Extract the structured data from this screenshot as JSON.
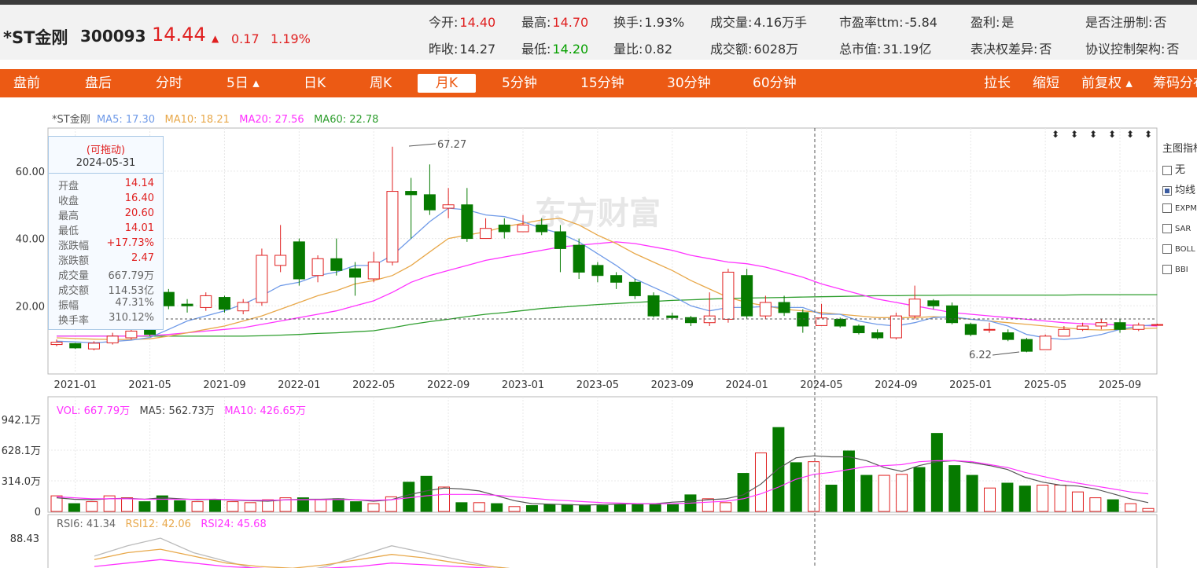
{
  "stock": {
    "name": "*ST金刚",
    "code": "300093",
    "price": "14.44",
    "arrow": "▲",
    "change": "0.17",
    "change_pct": "1.19%"
  },
  "stats_row1": [
    {
      "label": "今开:",
      "value": "14.40",
      "color": "red"
    },
    {
      "label": "最高:",
      "value": "14.70",
      "color": "red"
    },
    {
      "label": "换手:",
      "value": "1.93%",
      "color": "normal"
    },
    {
      "label": "成交量:",
      "value": "4.16万手",
      "color": "normal"
    },
    {
      "label": "市盈率ttm:",
      "value": "-5.84",
      "color": "normal"
    },
    {
      "label": "盈利:",
      "value": "是",
      "color": "normal"
    },
    {
      "label": "是否注册制:",
      "value": "否",
      "color": "normal"
    }
  ],
  "stats_row2": [
    {
      "label": "昨收:",
      "value": "14.27",
      "color": "normal"
    },
    {
      "label": "最低:",
      "value": "14.20",
      "color": "green"
    },
    {
      "label": "量比:",
      "value": "0.82",
      "color": "normal"
    },
    {
      "label": "成交额:",
      "value": "6028万",
      "color": "normal"
    },
    {
      "label": "总市值:",
      "value": "31.19亿",
      "color": "normal"
    },
    {
      "label": "表决权差异:",
      "value": "否",
      "color": "normal"
    },
    {
      "label": "协议控制架构:",
      "value": "否",
      "color": "normal"
    }
  ],
  "tabs": [
    "盘前",
    "盘后",
    "分时",
    "5日 ▴",
    "日K",
    "周K",
    "月K",
    "5分钟",
    "15分钟",
    "30分钟",
    "60分钟"
  ],
  "active_tab": "月K",
  "right_tabs": [
    "拉长",
    "缩短",
    "前复权 ▴",
    "筹码分布"
  ],
  "ma_legend": {
    "name": "*ST金刚",
    "ma5": "MA5: 17.30",
    "ma10": "MA10: 18.21",
    "ma20": "MA20: 27.56",
    "ma60": "MA60: 22.78"
  },
  "tooltip": {
    "draggable": "(可拖动)",
    "date": "2024-05-31",
    "rows": [
      {
        "k": "开盘",
        "v": "14.14"
      },
      {
        "k": "收盘",
        "v": "16.40"
      },
      {
        "k": "最高",
        "v": "20.60"
      },
      {
        "k": "最低",
        "v": "14.01"
      },
      {
        "k": "涨跌幅",
        "v": "+17.73%"
      },
      {
        "k": "涨跌额",
        "v": "2.47"
      },
      {
        "k": "成交量",
        "v": "667.79万"
      },
      {
        "k": "成交额",
        "v": "114.53亿"
      },
      {
        "k": "振幅",
        "v": "47.31%"
      },
      {
        "k": "换手率",
        "v": "310.12%"
      }
    ]
  },
  "watermark": "东方财富",
  "indicator_panel": {
    "title": "主图指标",
    "items": [
      {
        "label": "无",
        "checked": false
      },
      {
        "label": "均线",
        "checked": true
      },
      {
        "label": "EXPMA",
        "checked": false
      },
      {
        "label": "SAR",
        "checked": false
      },
      {
        "label": "BOLL",
        "checked": false
      },
      {
        "label": "BBI",
        "checked": false
      }
    ]
  },
  "price_axis": {
    "labels": [
      "60.00",
      "40.00",
      "20.00"
    ]
  },
  "annotations": {
    "high": "67.27",
    "low": "6.22"
  },
  "time_axis": [
    "2021-01",
    "2021-05",
    "2021-09",
    "2022-01",
    "2022-05",
    "2022-09",
    "2023-01",
    "2023-05",
    "2023-09",
    "2024-01",
    "2024-05",
    "2024-09",
    "2025-01",
    "2025-05",
    "2025-09"
  ],
  "vol_legend": {
    "vol": "VOL: 667.79万",
    "ma5": "MA5: 562.73万",
    "ma10": "MA10: 426.65万"
  },
  "vol_axis": {
    "labels": [
      "942.1万",
      "628.1万",
      "314.0万",
      "0"
    ]
  },
  "rsi_legend": {
    "rsi6": "RSI6: 41.34",
    "rsi12": "RSI12: 42.06",
    "rsi24": "RSI24: 45.68"
  },
  "rsi_axis": {
    "labels": [
      "88.43"
    ]
  },
  "colors": {
    "up": "#e02020",
    "down": "#067a00",
    "ma5": "#6f9ae8",
    "ma10": "#e8a84a",
    "ma20": "#ff33ff",
    "ma60": "#2e9e2e",
    "accent": "#ec5a14"
  },
  "chart_data": {
    "type": "candlestick",
    "title": "",
    "interval": "month",
    "x": [
      "2020-12",
      "2021-01",
      "2021-02",
      "2021-03",
      "2021-04",
      "2021-05",
      "2021-06",
      "2021-07",
      "2021-08",
      "2021-09",
      "2021-10",
      "2021-11",
      "2021-12",
      "2022-01",
      "2022-02",
      "2022-03",
      "2022-04",
      "2022-05",
      "2022-06",
      "2022-07",
      "2022-08",
      "2022-09",
      "2022-10",
      "2022-11",
      "2022-12",
      "2023-01",
      "2023-02",
      "2023-03",
      "2023-04",
      "2023-05",
      "2023-06",
      "2023-07",
      "2023-08",
      "2023-09",
      "2023-10",
      "2023-11",
      "2023-12",
      "2024-01",
      "2024-02",
      "2024-03",
      "2024-04",
      "2024-05",
      "2024-06",
      "2024-07",
      "2024-08",
      "2024-09",
      "2024-10",
      "2024-11",
      "2024-12",
      "2025-01",
      "2025-02",
      "2025-03",
      "2025-04",
      "2025-05",
      "2025-06",
      "2025-07",
      "2025-08",
      "2025-09",
      "2025-10",
      "2025-11"
    ],
    "candles": [
      [
        8.5,
        9.2,
        10.0,
        8.0
      ],
      [
        8.8,
        7.5,
        9.0,
        7.2
      ],
      [
        7.2,
        8.9,
        9.5,
        6.8
      ],
      [
        9.0,
        11.0,
        12.0,
        8.5
      ],
      [
        10.5,
        12.5,
        13.0,
        10.0
      ],
      [
        13.0,
        11.5,
        14.0,
        11.0
      ],
      [
        24.0,
        20.0,
        25.0,
        19.0
      ],
      [
        20.5,
        20.0,
        22.0,
        18.0
      ],
      [
        19.5,
        23.0,
        24.0,
        18.5
      ],
      [
        22.5,
        19.0,
        23.0,
        18.0
      ],
      [
        18.5,
        21.0,
        22.0,
        17.5
      ],
      [
        21.0,
        35.0,
        37.0,
        20.0
      ],
      [
        32.0,
        35.0,
        44.0,
        30.0
      ],
      [
        39.0,
        28.0,
        40.0,
        26.0
      ],
      [
        29.0,
        34.0,
        35.0,
        27.0
      ],
      [
        34.0,
        30.5,
        40.0,
        29.0
      ],
      [
        31.0,
        28.5,
        33.0,
        23.0
      ],
      [
        28.0,
        33.0,
        36.0,
        27.0
      ],
      [
        33.0,
        54.0,
        67.27,
        32.0
      ],
      [
        54.0,
        53.0,
        58.0,
        40.0
      ],
      [
        53.0,
        48.5,
        62.0,
        47.0
      ],
      [
        49.0,
        50.0,
        55.0,
        46.0
      ],
      [
        50.0,
        40.0,
        55.0,
        39.0
      ],
      [
        40.0,
        43.0,
        46.0,
        40.0
      ],
      [
        44.0,
        42.0,
        46.0,
        40.0
      ],
      [
        42.0,
        44.0,
        47.0,
        42.0
      ],
      [
        44.0,
        42.0,
        46.0,
        41.0
      ],
      [
        42.0,
        37.0,
        44.0,
        30.0
      ],
      [
        38.0,
        30.0,
        40.0,
        28.0
      ],
      [
        32.0,
        29.0,
        33.0,
        27.0
      ],
      [
        29.0,
        27.0,
        30.0,
        25.0
      ],
      [
        27.0,
        23.0,
        28.0,
        22.0
      ],
      [
        23.0,
        17.0,
        24.0,
        16.5
      ],
      [
        17.0,
        16.5,
        18.0,
        16.0
      ],
      [
        16.5,
        15.0,
        17.0,
        14.0
      ],
      [
        15.0,
        17.0,
        24.0,
        14.0
      ],
      [
        16.0,
        30.0,
        31.0,
        15.0
      ],
      [
        29.0,
        17.0,
        31.0,
        16.0
      ],
      [
        17.0,
        21.0,
        23.0,
        16.0
      ],
      [
        21.0,
        18.0,
        23.0,
        17.0
      ],
      [
        18.0,
        14.0,
        19.0,
        12.0
      ],
      [
        14.14,
        16.4,
        20.6,
        14.01
      ],
      [
        16.0,
        14.0,
        16.5,
        13.5
      ],
      [
        14.0,
        12.0,
        14.5,
        11.5
      ],
      [
        12.0,
        10.5,
        13.0,
        10.0
      ],
      [
        10.5,
        17.0,
        18.0,
        10.0
      ],
      [
        17.0,
        22.0,
        26.0,
        16.0
      ],
      [
        21.5,
        20.0,
        22.0,
        19.0
      ],
      [
        20.0,
        15.0,
        21.0,
        14.5
      ],
      [
        14.5,
        11.5,
        15.0,
        11.0
      ],
      [
        13.0,
        13.0,
        15.0,
        12.0
      ],
      [
        12.0,
        10.0,
        13.0,
        9.5
      ],
      [
        10.0,
        6.5,
        10.5,
        6.22
      ],
      [
        7.0,
        11.0,
        11.5,
        7.0
      ],
      [
        11.0,
        13.0,
        14.0,
        11.0
      ],
      [
        13.0,
        14.0,
        15.0,
        12.5
      ],
      [
        14.0,
        15.0,
        16.0,
        13.0
      ],
      [
        15.0,
        13.0,
        16.0,
        12.0
      ],
      [
        13.0,
        14.27,
        15.0,
        12.5
      ],
      [
        14.4,
        14.44,
        14.7,
        14.2
      ]
    ],
    "ma5": [
      9.5,
      9.3,
      9.0,
      9.4,
      9.8,
      10.6,
      13.0,
      15.5,
      17.0,
      18.5,
      20.5,
      23.0,
      26.0,
      27.0,
      29.0,
      30.0,
      32.0,
      32.0,
      35.0,
      40.0,
      45.0,
      49.0,
      48.5,
      47.0,
      46.5,
      45.0,
      43.0,
      41.5,
      39.0,
      35.5,
      32.0,
      28.0,
      25.5,
      23.0,
      20.0,
      18.5,
      19.5,
      19.5,
      19.8,
      19.5,
      19.5,
      17.5,
      17.5,
      15.5,
      14.5,
      14.0,
      15.0,
      16.5,
      16.8,
      16.0,
      15.5,
      14.0,
      11.5,
      10.5,
      10.0,
      10.5,
      11.5,
      13.0,
      14.0,
      14.4
    ],
    "ma10": [
      10.5,
      10.3,
      10.1,
      10.0,
      10.0,
      10.2,
      11.0,
      12.0,
      13.0,
      14.0,
      15.5,
      17.0,
      19.0,
      21.0,
      23.0,
      24.5,
      26.5,
      27.5,
      29.0,
      32.0,
      36.0,
      40.0,
      41.0,
      42.0,
      43.5,
      44.5,
      45.5,
      46.0,
      44.0,
      41.0,
      38.5,
      35.5,
      33.0,
      30.5,
      27.5,
      25.0,
      22.5,
      21.0,
      20.0,
      19.0,
      18.5,
      18.0,
      17.5,
      17.0,
      16.5,
      16.5,
      16.5,
      16.8,
      16.5,
      16.0,
      15.5,
      15.0,
      14.5,
      14.0,
      13.5,
      13.0,
      12.8,
      13.0,
      13.2,
      13.4
    ],
    "ma20": [
      11.0,
      11.0,
      11.0,
      11.0,
      11.0,
      11.1,
      11.5,
      12.0,
      12.5,
      13.0,
      13.5,
      14.5,
      15.5,
      16.5,
      17.5,
      18.5,
      20.0,
      21.5,
      24.0,
      27.0,
      29.0,
      30.5,
      32.0,
      33.5,
      34.5,
      35.5,
      36.5,
      37.5,
      38.0,
      38.5,
      39.0,
      38.5,
      37.5,
      36.5,
      35.0,
      34.0,
      33.0,
      32.5,
      31.5,
      30.0,
      28.5,
      26.5,
      25.0,
      23.5,
      22.0,
      21.0,
      20.0,
      19.0,
      18.0,
      17.5,
      17.0,
      16.5,
      16.0,
      15.5,
      15.0,
      14.7,
      14.5,
      14.3,
      14.2,
      14.0
    ],
    "ma60": [
      11.0,
      11.0,
      11.0,
      11.0,
      11.0,
      11.0,
      11.0,
      11.0,
      11.0,
      11.0,
      11.0,
      11.1,
      11.3,
      11.5,
      11.8,
      12.0,
      12.3,
      12.6,
      13.5,
      14.5,
      15.3,
      16.0,
      16.8,
      17.5,
      18.0,
      18.6,
      19.2,
      19.6,
      20.0,
      20.4,
      20.7,
      21.0,
      21.3,
      21.6,
      21.8,
      22.0,
      22.2,
      22.3,
      22.4,
      22.5,
      22.6,
      22.7,
      22.8,
      22.9,
      23.0,
      23.0,
      23.1,
      23.1,
      23.2,
      23.2,
      23.2,
      23.2,
      23.2,
      23.2,
      23.2,
      23.3,
      23.3,
      23.3,
      23.3,
      23.3
    ],
    "volume": [
      160,
      80,
      100,
      160,
      140,
      100,
      160,
      110,
      100,
      120,
      100,
      90,
      120,
      140,
      140,
      120,
      130,
      100,
      80,
      150,
      300,
      360,
      250,
      90,
      90,
      80,
      50,
      60,
      70,
      70,
      65,
      60,
      70,
      80,
      80,
      70,
      170,
      130,
      90,
      390,
      600,
      860,
      500,
      510,
      270,
      620,
      370,
      370,
      380,
      450,
      800,
      470,
      370,
      240,
      290,
      260,
      270,
      270,
      200,
      140,
      120,
      80,
      30
    ],
    "vol_ma5": [
      140,
      125,
      120,
      130,
      135,
      125,
      140,
      130,
      120,
      125,
      115,
      110,
      105,
      120,
      125,
      125,
      130,
      120,
      105,
      120,
      170,
      210,
      240,
      230,
      210,
      160,
      110,
      80,
      75,
      70,
      65,
      70,
      75,
      80,
      80,
      95,
      105,
      120,
      130,
      170,
      280,
      440,
      550,
      570,
      560,
      560,
      520,
      450,
      410,
      470,
      510,
      520,
      500,
      470,
      430,
      350,
      300,
      270,
      260,
      230,
      180,
      130,
      90
    ],
    "vol_ma10": [
      150,
      140,
      130,
      130,
      130,
      125,
      125,
      125,
      125,
      125,
      120,
      115,
      115,
      118,
      120,
      120,
      122,
      120,
      115,
      120,
      140,
      160,
      175,
      175,
      175,
      165,
      150,
      135,
      120,
      110,
      100,
      90,
      85,
      80,
      78,
      80,
      85,
      95,
      105,
      130,
      180,
      250,
      330,
      380,
      400,
      430,
      460,
      470,
      480,
      510,
      520,
      520,
      510,
      480,
      450,
      400,
      360,
      320,
      290,
      260,
      230,
      200,
      180
    ],
    "vol_max": 942.1,
    "rsi6": [
      78,
      84,
      88.43,
      80,
      75,
      70,
      68,
      72,
      78,
      84,
      80,
      76,
      72,
      70,
      68,
      65,
      62,
      60
    ],
    "rsi12": [
      76,
      80,
      82,
      78,
      74,
      72,
      71,
      73,
      76,
      79,
      77,
      74,
      72,
      70,
      69,
      67,
      65,
      63
    ],
    "rsi24": [
      72,
      74,
      76,
      74,
      72,
      71,
      70,
      71,
      72,
      74,
      73,
      72,
      71,
      70,
      69,
      68,
      67,
      66
    ],
    "ylim": [
      0,
      75
    ]
  }
}
